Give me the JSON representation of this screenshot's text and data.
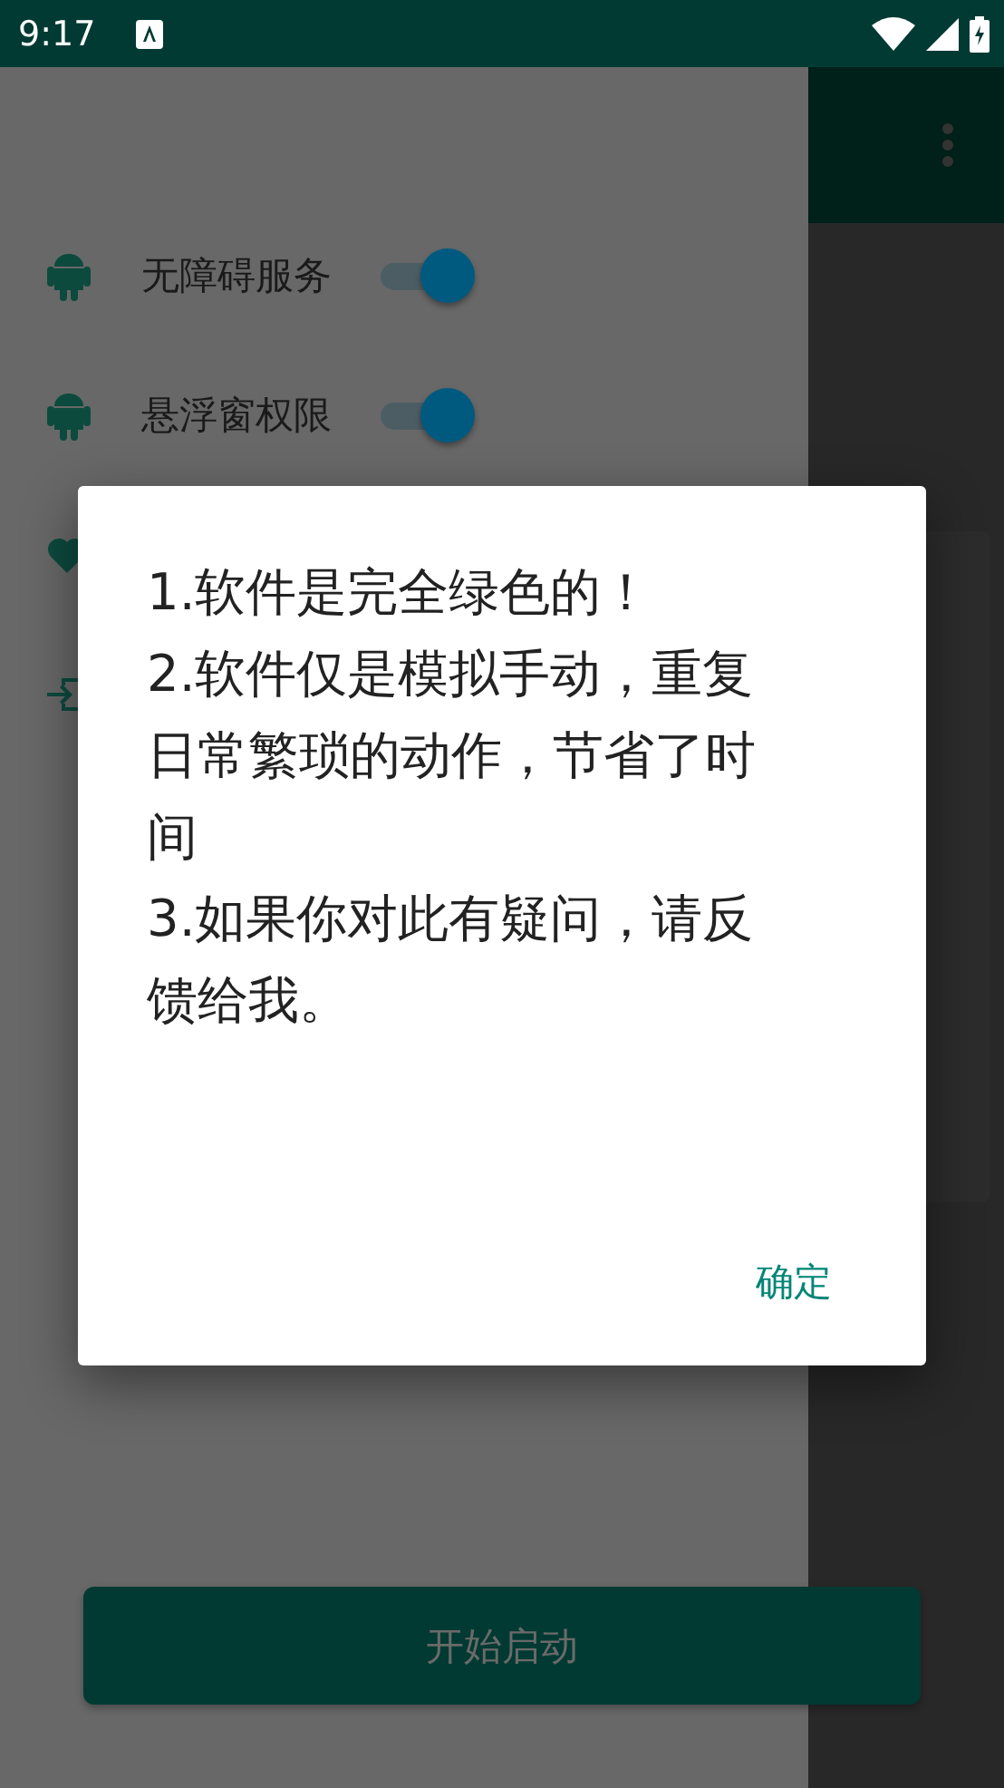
{
  "status_bar": {
    "time": "9:17"
  },
  "drawer": {
    "items": [
      {
        "kind": "switch",
        "label": "无障碍服务",
        "checked": true
      },
      {
        "kind": "switch",
        "label": "悬浮窗权限",
        "checked": true
      },
      {
        "kind": "heart"
      },
      {
        "kind": "exit"
      }
    ]
  },
  "start_button": {
    "label": "开始启动",
    "disabled": true
  },
  "dialog": {
    "message": "1.软件是完全绿色的！\n2.软件仅是模拟手动，重复日常繁琐的动作，节省了时间\n3.如果你对此有疑问，请反馈给我。",
    "buttons": [
      "确定"
    ]
  }
}
